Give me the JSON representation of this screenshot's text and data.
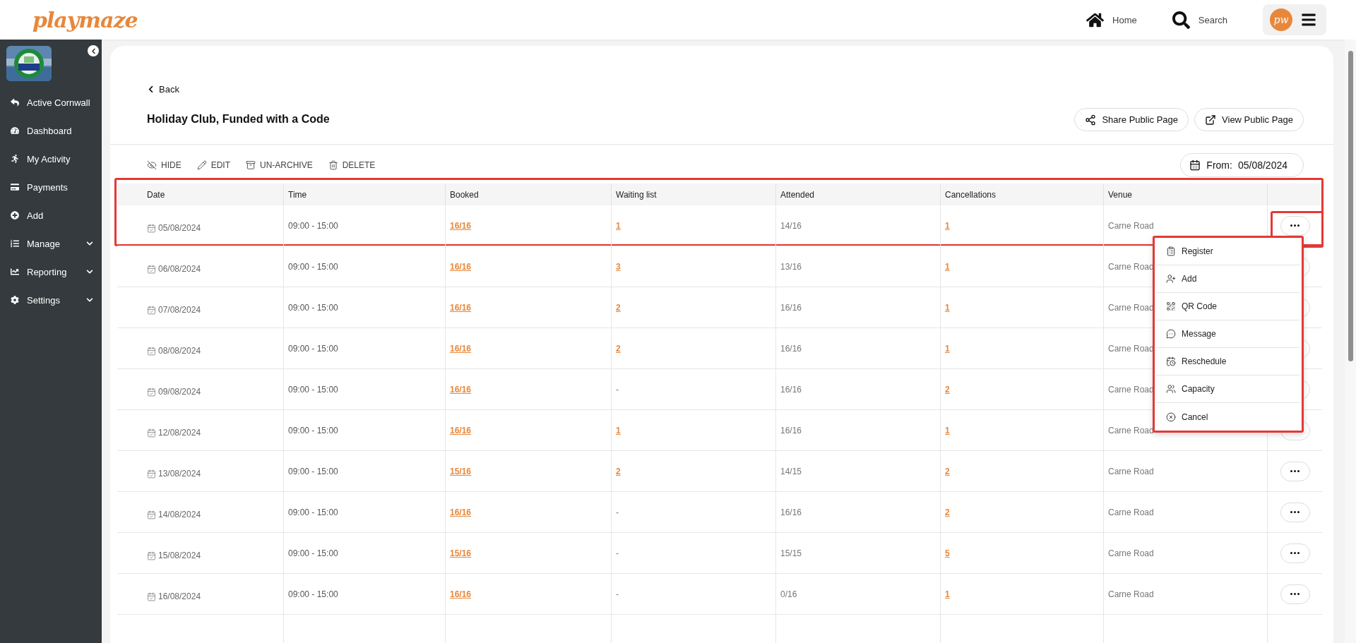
{
  "header": {
    "logo": "playmaze",
    "nav": [
      {
        "label": "Home"
      },
      {
        "label": "Search"
      }
    ],
    "avatar": "pw"
  },
  "sidebar": {
    "items": [
      {
        "label": "Active Cornwall",
        "expandable": false
      },
      {
        "label": "Dashboard",
        "expandable": false
      },
      {
        "label": "My Activity",
        "expandable": false
      },
      {
        "label": "Payments",
        "expandable": false
      },
      {
        "label": "Add",
        "expandable": false
      },
      {
        "label": "Manage",
        "expandable": true
      },
      {
        "label": "Reporting",
        "expandable": true
      },
      {
        "label": "Settings",
        "expandable": true
      }
    ]
  },
  "page": {
    "back": "Back",
    "title": "Holiday Club, Funded with a Code",
    "buttons": [
      "Share Public Page",
      "View Public Page"
    ],
    "actions": [
      "HIDE",
      "EDIT",
      "UN-ARCHIVE",
      "DELETE"
    ],
    "from_label": "From:",
    "from_date": "05/08/2024"
  },
  "table": {
    "columns": [
      "Date",
      "Time",
      "Booked",
      "Waiting list",
      "Attended",
      "Cancellations",
      "Venue"
    ],
    "first_row_highlighted": true,
    "rows": [
      {
        "action_highlighted": true,
        "cells": [
          {
            "kind": "date",
            "text": "05/08/2024"
          },
          {
            "kind": "time",
            "text": "09:00 - 15:00"
          },
          {
            "kind": "link",
            "text": "16/16"
          },
          {
            "kind": "link",
            "text": "1"
          },
          {
            "kind": "plain",
            "text": "14/16"
          },
          {
            "kind": "link",
            "text": "1"
          },
          {
            "kind": "plain",
            "text": "Carne Road"
          }
        ]
      },
      {
        "action_highlighted": false,
        "cells": [
          {
            "kind": "date",
            "text": "06/08/2024"
          },
          {
            "kind": "time",
            "text": "09:00 - 15:00"
          },
          {
            "kind": "link",
            "text": "16/16"
          },
          {
            "kind": "link",
            "text": "3"
          },
          {
            "kind": "plain",
            "text": "13/16"
          },
          {
            "kind": "link",
            "text": "1"
          },
          {
            "kind": "plain",
            "text": "Carne Road"
          }
        ]
      },
      {
        "action_highlighted": false,
        "cells": [
          {
            "kind": "date",
            "text": "07/08/2024"
          },
          {
            "kind": "time",
            "text": "09:00 - 15:00"
          },
          {
            "kind": "link",
            "text": "16/16"
          },
          {
            "kind": "link",
            "text": "2"
          },
          {
            "kind": "plain",
            "text": "16/16"
          },
          {
            "kind": "link",
            "text": "1"
          },
          {
            "kind": "plain",
            "text": "Carne Road"
          }
        ]
      },
      {
        "action_highlighted": false,
        "cells": [
          {
            "kind": "date",
            "text": "08/08/2024"
          },
          {
            "kind": "time",
            "text": "09:00 - 15:00"
          },
          {
            "kind": "link",
            "text": "16/16"
          },
          {
            "kind": "link",
            "text": "2"
          },
          {
            "kind": "plain",
            "text": "16/16"
          },
          {
            "kind": "link",
            "text": "1"
          },
          {
            "kind": "plain",
            "text": "Carne Road"
          }
        ]
      },
      {
        "action_highlighted": false,
        "cells": [
          {
            "kind": "date",
            "text": "09/08/2024"
          },
          {
            "kind": "time",
            "text": "09:00 - 15:00"
          },
          {
            "kind": "link",
            "text": "16/16"
          },
          {
            "kind": "plain",
            "text": "-"
          },
          {
            "kind": "plain",
            "text": "16/16"
          },
          {
            "kind": "link",
            "text": "2"
          },
          {
            "kind": "plain",
            "text": "Carne Road"
          }
        ]
      },
      {
        "action_highlighted": false,
        "cells": [
          {
            "kind": "date",
            "text": "12/08/2024"
          },
          {
            "kind": "time",
            "text": "09:00 - 15:00"
          },
          {
            "kind": "link",
            "text": "16/16"
          },
          {
            "kind": "link",
            "text": "1"
          },
          {
            "kind": "plain",
            "text": "16/16"
          },
          {
            "kind": "link",
            "text": "1"
          },
          {
            "kind": "plain",
            "text": "Carne Road"
          }
        ]
      },
      {
        "action_highlighted": false,
        "cells": [
          {
            "kind": "date",
            "text": "13/08/2024"
          },
          {
            "kind": "time",
            "text": "09:00 - 15:00"
          },
          {
            "kind": "link",
            "text": "15/16"
          },
          {
            "kind": "link",
            "text": "2"
          },
          {
            "kind": "plain",
            "text": "14/15"
          },
          {
            "kind": "link",
            "text": "2"
          },
          {
            "kind": "plain",
            "text": "Carne Road"
          }
        ]
      },
      {
        "action_highlighted": false,
        "cells": [
          {
            "kind": "date",
            "text": "14/08/2024"
          },
          {
            "kind": "time",
            "text": "09:00 - 15:00"
          },
          {
            "kind": "link",
            "text": "16/16"
          },
          {
            "kind": "plain",
            "text": "-"
          },
          {
            "kind": "plain",
            "text": "16/16"
          },
          {
            "kind": "link",
            "text": "2"
          },
          {
            "kind": "plain",
            "text": "Carne Road"
          }
        ]
      },
      {
        "action_highlighted": false,
        "cells": [
          {
            "kind": "date",
            "text": "15/08/2024"
          },
          {
            "kind": "time",
            "text": "09:00 - 15:00"
          },
          {
            "kind": "link",
            "text": "15/16"
          },
          {
            "kind": "plain",
            "text": "-"
          },
          {
            "kind": "plain",
            "text": "15/15"
          },
          {
            "kind": "link",
            "text": "5"
          },
          {
            "kind": "plain",
            "text": "Carne Road"
          }
        ]
      },
      {
        "action_highlighted": false,
        "cells": [
          {
            "kind": "date",
            "text": "16/08/2024"
          },
          {
            "kind": "time",
            "text": "09:00 - 15:00"
          },
          {
            "kind": "link",
            "text": "16/16"
          },
          {
            "kind": "plain",
            "text": "-"
          },
          {
            "kind": "plain",
            "text": "0/16"
          },
          {
            "kind": "link",
            "text": "1"
          },
          {
            "kind": "plain",
            "text": "Carne Road"
          }
        ]
      }
    ]
  },
  "row_menu": {
    "highlighted": true,
    "items": [
      "Register",
      "Add",
      "QR Code",
      "Message",
      "Reschedule",
      "Capacity",
      "Cancel"
    ]
  }
}
